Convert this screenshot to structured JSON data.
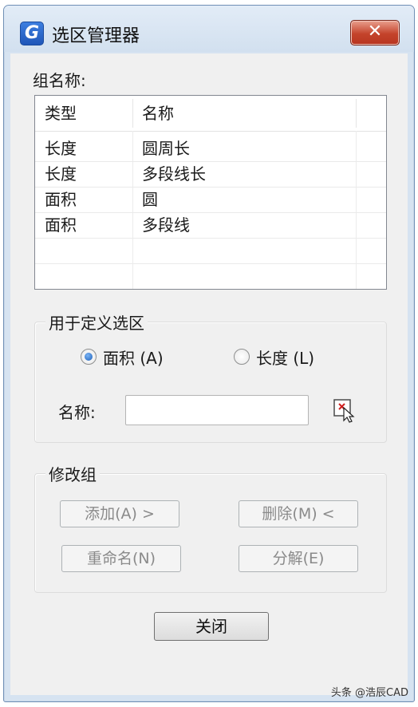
{
  "window": {
    "title": "选区管理器",
    "close_glyph": "✕",
    "app_icon_letter": "G"
  },
  "group_name_label": "组名称:",
  "list": {
    "columns": [
      "类型",
      "名称"
    ],
    "rows": [
      [
        "长度",
        "圆周长"
      ],
      [
        "长度",
        "多段线长"
      ],
      [
        "面积",
        "圆"
      ],
      [
        "面积",
        "多段线"
      ]
    ]
  },
  "define_group": {
    "title": "用于定义选区",
    "radio_area": {
      "label": "面积 (A)",
      "selected": true
    },
    "radio_length": {
      "label": "长度 (L)",
      "selected": false
    },
    "name_label": "名称:",
    "name_value": "",
    "pick_icon": "pick-select-icon"
  },
  "modify_group": {
    "title": "修改组",
    "add_label": "添加(A) >",
    "delete_label": "删除(M) <",
    "rename_label": "重命名(N)",
    "explode_label": "分解(E)"
  },
  "close_label": "关闭",
  "watermark": "头条 @浩辰CAD"
}
